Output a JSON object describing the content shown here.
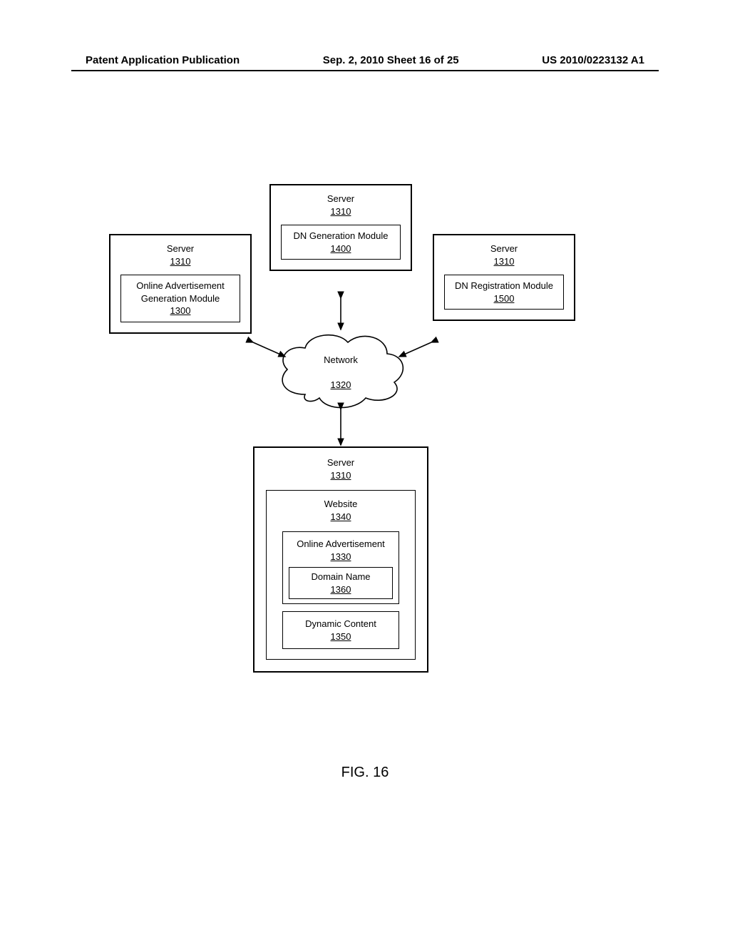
{
  "header": {
    "left": "Patent Application Publication",
    "center": "Sep. 2, 2010  Sheet 16 of 25",
    "right": "US 2010/0223132 A1"
  },
  "boxes": {
    "top_center": {
      "server": "Server",
      "server_ref": "1310",
      "mod": "DN Generation Module",
      "mod_ref": "1400"
    },
    "left": {
      "server": "Server",
      "server_ref": "1310",
      "mod": "Online Advertisement Generation Module",
      "mod_ref": "1300"
    },
    "right": {
      "server": "Server",
      "server_ref": "1310",
      "mod": "DN Registration Module",
      "mod_ref": "1500"
    },
    "bottom": {
      "server": "Server",
      "server_ref": "1310",
      "website": "Website",
      "website_ref": "1340",
      "ad": "Online Advertisement",
      "ad_ref": "1330",
      "dn": "Domain Name",
      "dn_ref": "1360",
      "dyn": "Dynamic Content",
      "dyn_ref": "1350"
    }
  },
  "network": {
    "label": "Network",
    "ref": "1320"
  },
  "figure": {
    "label": "FIG. 16"
  }
}
